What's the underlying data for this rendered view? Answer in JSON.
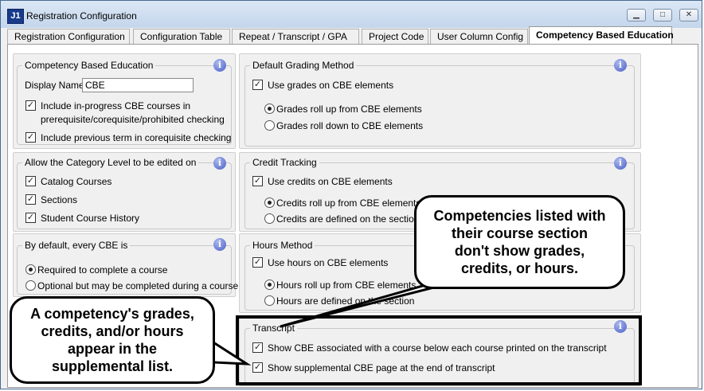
{
  "window": {
    "title": "Registration Configuration",
    "app_icon": "J1"
  },
  "tabs": [
    "Registration Configuration",
    "Configuration Table",
    "Repeat / Transcript / GPA",
    "Project Code",
    "User Column Config",
    "Competency Based Education"
  ],
  "cbe": {
    "title": "Competency Based Education",
    "display_name_label": "Display Name:",
    "display_name_value": "CBE",
    "inprogress_line1": "Include in-progress CBE courses in",
    "inprogress_line2": "prerequisite/corequisite/prohibited checking",
    "inprogress_checked": true,
    "previous_term": "Include previous term in corequisite checking",
    "previous_term_checked": true
  },
  "category": {
    "title": "Allow the Category Level to be edited on",
    "items": [
      "Catalog Courses",
      "Sections",
      "Student Course History"
    ]
  },
  "default_cbe": {
    "title": "By default, every CBE is",
    "options": [
      "Required to complete a course",
      "Optional but may be completed during a course"
    ],
    "selected": 0
  },
  "grading": {
    "title": "Default Grading Method",
    "use_label": "Use grades on CBE elements",
    "options": [
      "Grades roll up from CBE elements",
      "Grades roll down to CBE elements"
    ],
    "selected": 0
  },
  "credit": {
    "title": "Credit Tracking",
    "use_label": "Use credits on CBE elements",
    "options": [
      "Credits roll up from CBE elements",
      "Credits are defined on the section"
    ],
    "selected": 0
  },
  "hours": {
    "title": "Hours Method",
    "use_label": "Use hours on CBE elements",
    "options": [
      "Hours roll up from CBE elements",
      "Hours are defined on the section"
    ],
    "selected": 0
  },
  "transcript": {
    "title": "Transcript",
    "show_below": "Show CBE associated with a course below each course printed on the transcript",
    "show_supplemental": "Show supplemental CBE page at the end of transcript"
  },
  "callouts": {
    "right": "Competencies listed with\ntheir course section\ndon't show grades,\ncredits, or hours.",
    "left": "A competency's grades,\ncredits, and/or hours\nappear in the\nsupplemental list."
  }
}
